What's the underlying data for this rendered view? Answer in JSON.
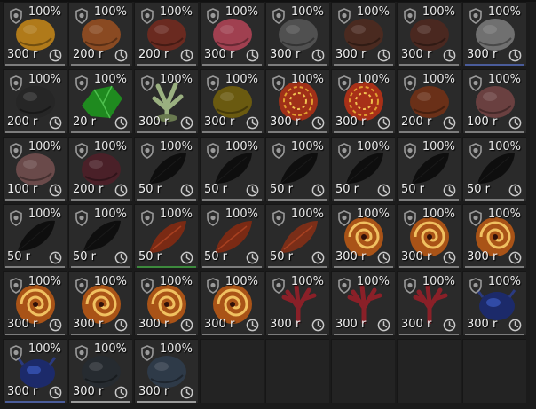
{
  "items": [
    {
      "durability": "100%",
      "price": "300 r",
      "icon": "yellow-creature",
      "color": "#b07a1a",
      "line": "gray"
    },
    {
      "durability": "100%",
      "price": "200 r",
      "icon": "tiger-creature",
      "color": "#8a4a22",
      "line": "gray"
    },
    {
      "durability": "100%",
      "price": "200 r",
      "icon": "red-beast",
      "color": "#6a2a20",
      "line": "gray"
    },
    {
      "durability": "100%",
      "price": "300 r",
      "icon": "pink-ornament",
      "color": "#a04050",
      "line": "gray"
    },
    {
      "durability": "100%",
      "price": "300 r",
      "icon": "gray-beast",
      "color": "#505050",
      "line": "gray"
    },
    {
      "durability": "100%",
      "price": "300 r",
      "icon": "brown-shell",
      "color": "#4a2a20",
      "line": "gray"
    },
    {
      "durability": "100%",
      "price": "300 r",
      "icon": "brown-shell",
      "color": "#4a2820",
      "line": "gray"
    },
    {
      "durability": "100%",
      "price": "300 r",
      "icon": "white-flower",
      "color": "#707070",
      "line": "blue"
    },
    {
      "durability": "100%",
      "price": "200 r",
      "icon": "black-cloud",
      "color": "#262626",
      "line": "gray"
    },
    {
      "durability": "100%",
      "price": "20 r",
      "icon": "green-crystal",
      "color": "#1f8a1f",
      "line": "gray"
    },
    {
      "durability": "100%",
      "price": "300 r",
      "icon": "white-plant",
      "color": "#9ab080",
      "line": "gray"
    },
    {
      "durability": "100%",
      "price": "300 r",
      "icon": "gold-wings",
      "color": "#6a5a10",
      "line": "gray"
    },
    {
      "durability": "100%",
      "price": "300 r",
      "icon": "fire-orb",
      "color": "#a03018",
      "line": "gray"
    },
    {
      "durability": "100%",
      "price": "300 r",
      "icon": "fire-orb",
      "color": "#a83018",
      "line": "gray"
    },
    {
      "durability": "100%",
      "price": "200 r",
      "icon": "brown-dragon",
      "color": "#6a3018",
      "line": "gray"
    },
    {
      "durability": "100%",
      "price": "100 r",
      "icon": "patterned-beast",
      "color": "#6a4040",
      "line": "gray"
    },
    {
      "durability": "100%",
      "price": "100 r",
      "icon": "patterned-beast",
      "color": "#6a4a4a",
      "line": "gray"
    },
    {
      "durability": "100%",
      "price": "200 r",
      "icon": "red-serpent",
      "color": "#4a2028",
      "line": "gray"
    },
    {
      "durability": "100%",
      "price": "50 r",
      "icon": "black-feather",
      "color": "#0e0e0e",
      "line": "gray"
    },
    {
      "durability": "100%",
      "price": "50 r",
      "icon": "black-feather",
      "color": "#0e0e0e",
      "line": "gray"
    },
    {
      "durability": "100%",
      "price": "50 r",
      "icon": "black-feather",
      "color": "#0e0e0e",
      "line": "gray"
    },
    {
      "durability": "100%",
      "price": "50 r",
      "icon": "black-feather",
      "color": "#0e0e0e",
      "line": "gray"
    },
    {
      "durability": "100%",
      "price": "50 r",
      "icon": "black-feather",
      "color": "#0e0e0e",
      "line": "gray"
    },
    {
      "durability": "100%",
      "price": "50 r",
      "icon": "black-feather",
      "color": "#0e0e0e",
      "line": "gray"
    },
    {
      "durability": "100%",
      "price": "50 r",
      "icon": "black-feather",
      "color": "#0e0e0e",
      "line": "gray"
    },
    {
      "durability": "100%",
      "price": "50 r",
      "icon": "black-feather",
      "color": "#0e0e0e",
      "line": "gray"
    },
    {
      "durability": "100%",
      "price": "50 r",
      "icon": "red-feather",
      "color": "#7a2a14",
      "line": "green"
    },
    {
      "durability": "100%",
      "price": "50 r",
      "icon": "red-feather",
      "color": "#7a2a14",
      "line": "gray"
    },
    {
      "durability": "100%",
      "price": "50 r",
      "icon": "red-feather",
      "color": "#7a2e18",
      "line": "gray"
    },
    {
      "durability": "100%",
      "price": "300 r",
      "icon": "fire-spiral",
      "color": "#c05a14",
      "line": "gray"
    },
    {
      "durability": "100%",
      "price": "300 r",
      "icon": "fire-spiral",
      "color": "#c05a14",
      "line": "gray"
    },
    {
      "durability": "100%",
      "price": "300 r",
      "icon": "fire-spiral",
      "color": "#c05a14",
      "line": "gray"
    },
    {
      "durability": "100%",
      "price": "300 r",
      "icon": "fire-spiral",
      "color": "#c05a14",
      "line": "gray"
    },
    {
      "durability": "100%",
      "price": "300 r",
      "icon": "fire-spiral",
      "color": "#c05a14",
      "line": "gray"
    },
    {
      "durability": "100%",
      "price": "300 r",
      "icon": "fire-spiral",
      "color": "#c05a14",
      "line": "gray"
    },
    {
      "durability": "100%",
      "price": "300 r",
      "icon": "fire-spiral",
      "color": "#c05a14",
      "line": "gray"
    },
    {
      "durability": "100%",
      "price": "300 r",
      "icon": "red-coral",
      "color": "#8a2028",
      "line": "gray"
    },
    {
      "durability": "100%",
      "price": "300 r",
      "icon": "red-coral",
      "color": "#8a2028",
      "line": "gray"
    },
    {
      "durability": "100%",
      "price": "300 r",
      "icon": "red-coral",
      "color": "#8a2028",
      "line": "gray"
    },
    {
      "durability": "100%",
      "price": "300 r",
      "icon": "blue-beetle",
      "color": "#1c2a6a",
      "line": "gray"
    },
    {
      "durability": "100%",
      "price": "300 r",
      "icon": "blue-beetle",
      "color": "#1c2a6a",
      "line": "blue"
    },
    {
      "durability": "100%",
      "price": "300 r",
      "icon": "dark-creature",
      "color": "#262b30",
      "line": "white"
    },
    {
      "durability": "100%",
      "price": "300 r",
      "icon": "steel-beast",
      "color": "#2e3a48",
      "line": "white"
    }
  ],
  "ui": {
    "shield_color": "#9a9a9a",
    "clock_color": "#c8c8c8"
  }
}
